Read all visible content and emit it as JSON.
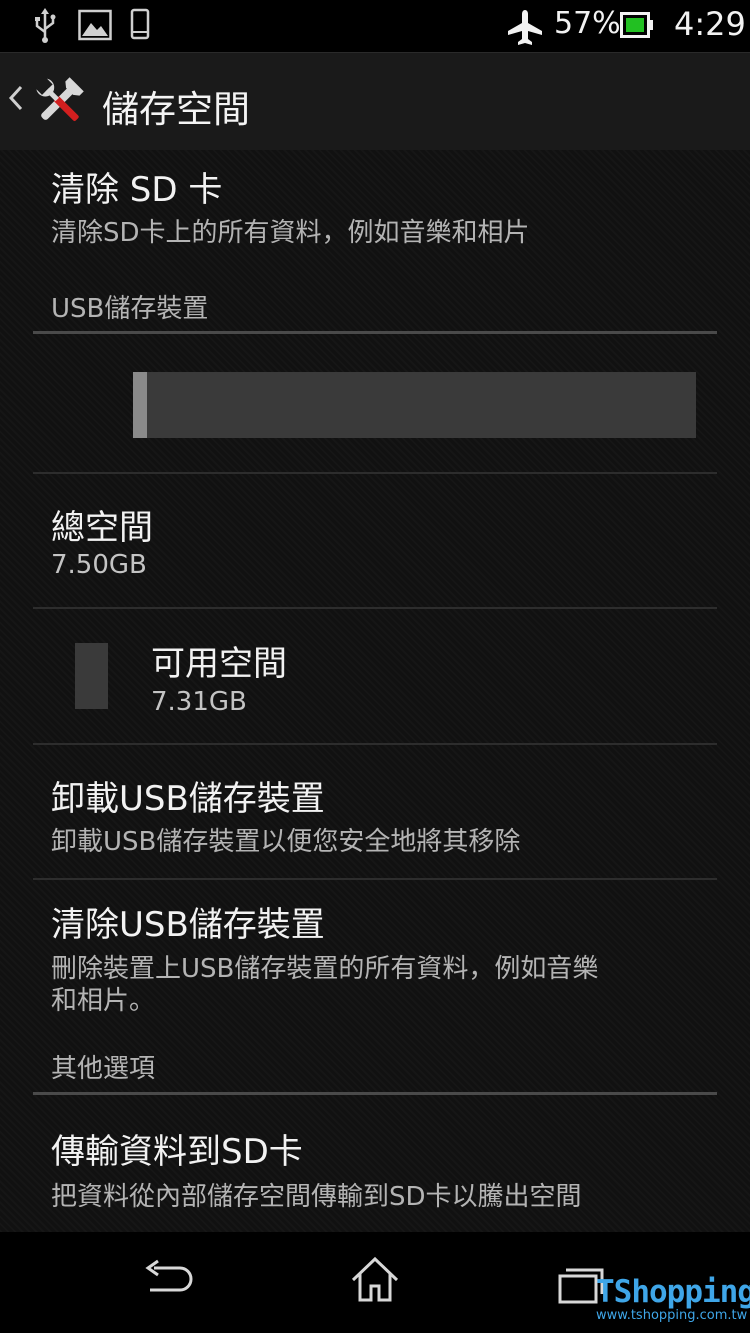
{
  "status_bar": {
    "battery_percent": "57%",
    "time": "4:29",
    "icons": [
      "usb-icon",
      "image-icon",
      "phone-icon",
      "airplane-mode-icon",
      "battery-icon"
    ]
  },
  "action_bar": {
    "title": "儲存空間",
    "icons": [
      "back-chevron-icon",
      "settings-tools-icon"
    ]
  },
  "items": {
    "erase_sd": {
      "title": "清除 SD 卡",
      "summary": "清除SD卡上的所有資料，例如音樂和相片"
    },
    "usb_storage_header": "USB儲存裝置",
    "usage_bar": {
      "used_fraction": 0.025
    },
    "total_space": {
      "title": "總空間",
      "value": "7.50GB"
    },
    "available_space": {
      "title": "可用空間",
      "value": "7.31GB"
    },
    "unmount_usb": {
      "title": "卸載USB儲存裝置",
      "summary": "卸載USB儲存裝置以便您安全地將其移除"
    },
    "erase_usb": {
      "title": "清除USB儲存裝置",
      "summary_line1": "刪除裝置上USB儲存裝置的所有資料，例如音樂",
      "summary_line2": "和相片。"
    },
    "other_options_header": "其他選項",
    "transfer_sd": {
      "title": "傳輸資料到SD卡",
      "summary": "把資料從內部儲存空間傳輸到SD卡以騰出空間"
    }
  },
  "nav_bar": {
    "icons": [
      "back-icon",
      "home-icon",
      "recent-apps-icon"
    ]
  },
  "watermark": {
    "name": "TShopping",
    "url": "www.tshopping.com.tw"
  },
  "colors": {
    "usage_used": "#8a8a8a",
    "usage_free": "#3a3a3a",
    "battery_fill": "#22c022",
    "watermark": "#3fa6e8"
  }
}
